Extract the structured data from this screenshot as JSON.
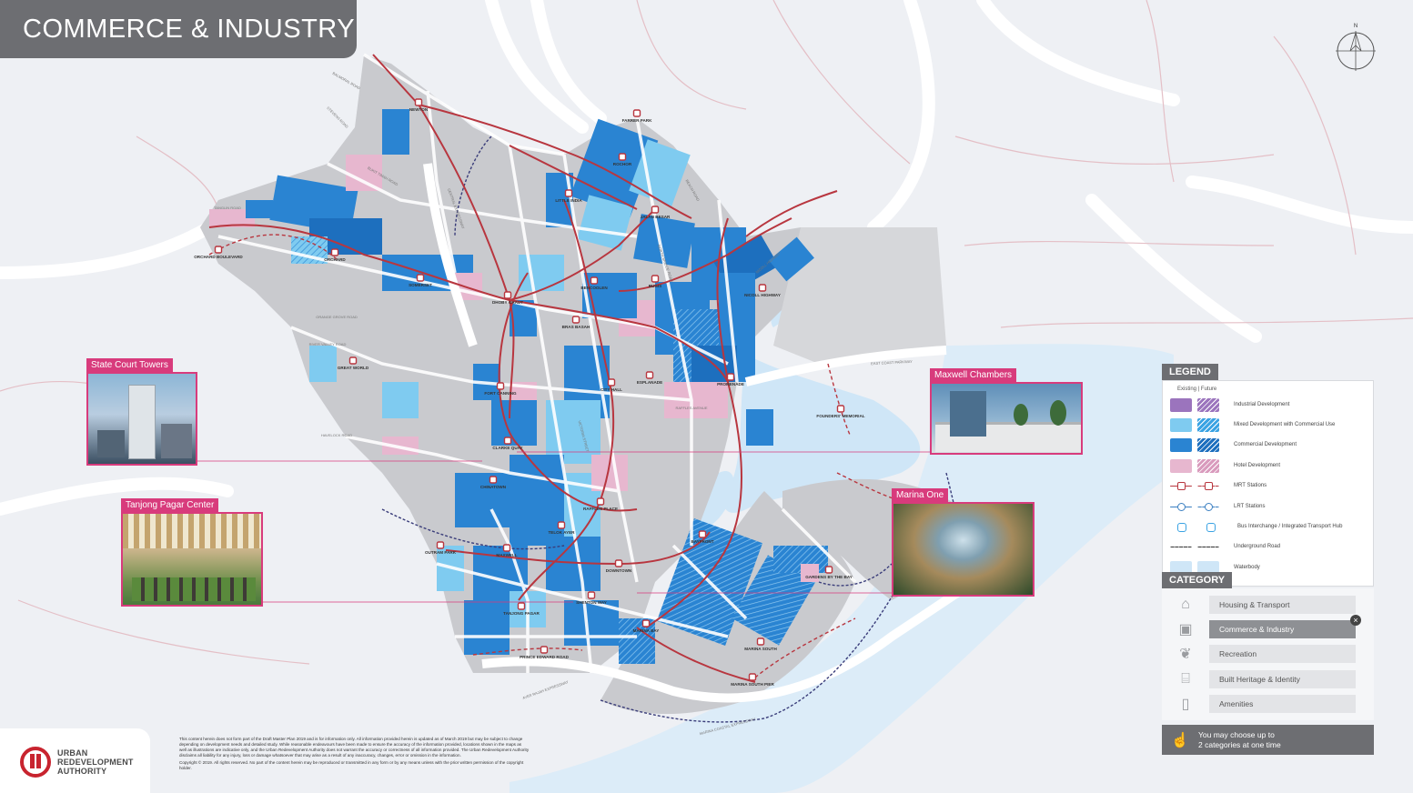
{
  "title": "COMMERCE & INDUSTRY",
  "compass_label": "N",
  "callouts": [
    {
      "id": "state-court",
      "label": "State Court Towers",
      "photo_colors": [
        "#7fa8c9",
        "#3b4f62"
      ]
    },
    {
      "id": "maxwell",
      "label": "Maxwell Chambers",
      "photo_colors": [
        "#5f8fb8",
        "#d9dde0"
      ]
    },
    {
      "id": "tanjong",
      "label": "Tanjong Pagar Center",
      "photo_colors": [
        "#c9b48a",
        "#4a7a3c"
      ]
    },
    {
      "id": "marina-one",
      "label": "Marina One",
      "photo_colors": [
        "#a58a5c",
        "#2e4a2a"
      ]
    }
  ],
  "stations": [
    "NEWTON",
    "OUTRAM PARK",
    "ORCHARD",
    "LITTLE INDIA",
    "FARRER PARK",
    "ROCHOR",
    "JALAN BESAR",
    "ORCHARD BOULEVARD",
    "SOMERSET",
    "DHOBY GHAUT",
    "BENCOOLEN",
    "BUGIS",
    "NICOLL HIGHWAY",
    "BRAS BASAH",
    "CITY HALL",
    "ESPLANADE",
    "PROMENADE",
    "FORT CANNING",
    "CLARKE QUAY",
    "GREAT WORLD",
    "CHINATOWN",
    "RAFFLES PLACE",
    "TELOK AYER",
    "MAXWELL",
    "DOWNTOWN",
    "BAYFRONT",
    "GARDENS BY THE BAY",
    "SHENTON WAY",
    "TANJONG PAGAR",
    "MARINA BAY",
    "MARINA SOUTH",
    "MARINA SOUTH PIER",
    "PRINCE EDWARD ROAD",
    "FOUNDERS' MEMORIAL"
  ],
  "roads": [
    "AYER RAJAH EXPRESSWAY",
    "EAST COAST PARKWAY",
    "CENTRAL EXPRESSWAY",
    "RIVER VALLEY ROAD",
    "HAVELOCK ROAD",
    "ORANGE GROVE ROAD",
    "NICOLL HIGHWAY",
    "RAFFLES AVENUE",
    "BALMORAL ROAD",
    "STEVENS ROAD",
    "BUKIT TIMAH ROAD",
    "VICTORIA STREET",
    "NORTH BRIDGE ROAD",
    "BEACH ROAD",
    "TANGLIN ROAD",
    "MARINA COASTAL EXPRESSWAY"
  ],
  "legend": {
    "title": "LEGEND",
    "existing_label": "Existing",
    "future_label": "Future",
    "items": [
      {
        "label": "Industrial Development",
        "existing": "#9b74bd",
        "future": "#9b74bd",
        "kind": "fill"
      },
      {
        "label": "Mixed Development with Commercial Use",
        "existing": "#7fcbf0",
        "future": "#3aa3e3",
        "kind": "fill"
      },
      {
        "label": "Commercial Development",
        "existing": "#2a84d2",
        "future": "#1d6fbe",
        "kind": "fill"
      },
      {
        "label": "Hotel Development",
        "existing": "#e7b7cf",
        "future": "#d99bbd",
        "kind": "fill"
      },
      {
        "label": "MRT Stations",
        "existing": "#b8363f",
        "future": "#b8363f",
        "kind": "mrt"
      },
      {
        "label": "LRT Stations",
        "existing": "#3a7fc1",
        "future": "#3a7fc1",
        "kind": "lrt"
      },
      {
        "label": "Bus Interchange / Integrated Transport Hub",
        "existing": "#3aa3e3",
        "future": "#3aa3e3",
        "kind": "bus"
      },
      {
        "label": "Underground Road",
        "existing": "#333333",
        "future": "#333333",
        "kind": "dash"
      },
      {
        "label": "Waterbody",
        "existing": "#cfe6f7",
        "future": "#cfe6f7",
        "kind": "water"
      }
    ]
  },
  "category": {
    "title": "CATEGORY",
    "items": [
      {
        "label": "Housing & Transport",
        "icon": "house-icon",
        "active": false
      },
      {
        "label": "Commerce & Industry",
        "icon": "briefcase-icon",
        "active": true
      },
      {
        "label": "Recreation",
        "icon": "leaf-icon",
        "active": false
      },
      {
        "label": "Built Heritage & Identity",
        "icon": "heritage-building-icon",
        "active": false
      },
      {
        "label": "Amenities",
        "icon": "amenity-box-icon",
        "active": false
      }
    ],
    "close_glyph": "×",
    "hint_line1": "You may choose up to",
    "hint_line2": "2 categories at one time"
  },
  "logo": {
    "line1": "URBAN",
    "line2": "REDEVELOPMENT",
    "line3": "AUTHORITY"
  },
  "disclaimer": [
    "This content herein does not form part of the Draft Master Plan 2019 and is for information only. All information provided herein is updated as of March 2019 but may be subject to change depending on development needs and detailed study. While reasonable endeavours have been made to ensure the accuracy of the information provided, locations shown in the maps as well as illustrations are indicative only, and the Urban Redevelopment Authority does not warrant the accuracy or correctness of all information provided. The Urban Redevelopment Authority disclaims all liability for any injury, loss or damage whatsoever that may arise as a result of any inaccuracy, changes, error or omission in the information.",
    "Copyright © 2019. All rights reserved. No part of the content herein may be reproduced or transmitted in any form or by any means unless with the prior written permission of the copyright holder."
  ],
  "colors": {
    "mrt_line": "#b8363f",
    "land": "#c9cace",
    "water": "#cfe6f7",
    "sea": "#dcecf8",
    "commercial": "#2a84d2",
    "mixed": "#7fcbf0",
    "hotel": "#e7b7cf",
    "accent": "#d83b7c"
  }
}
